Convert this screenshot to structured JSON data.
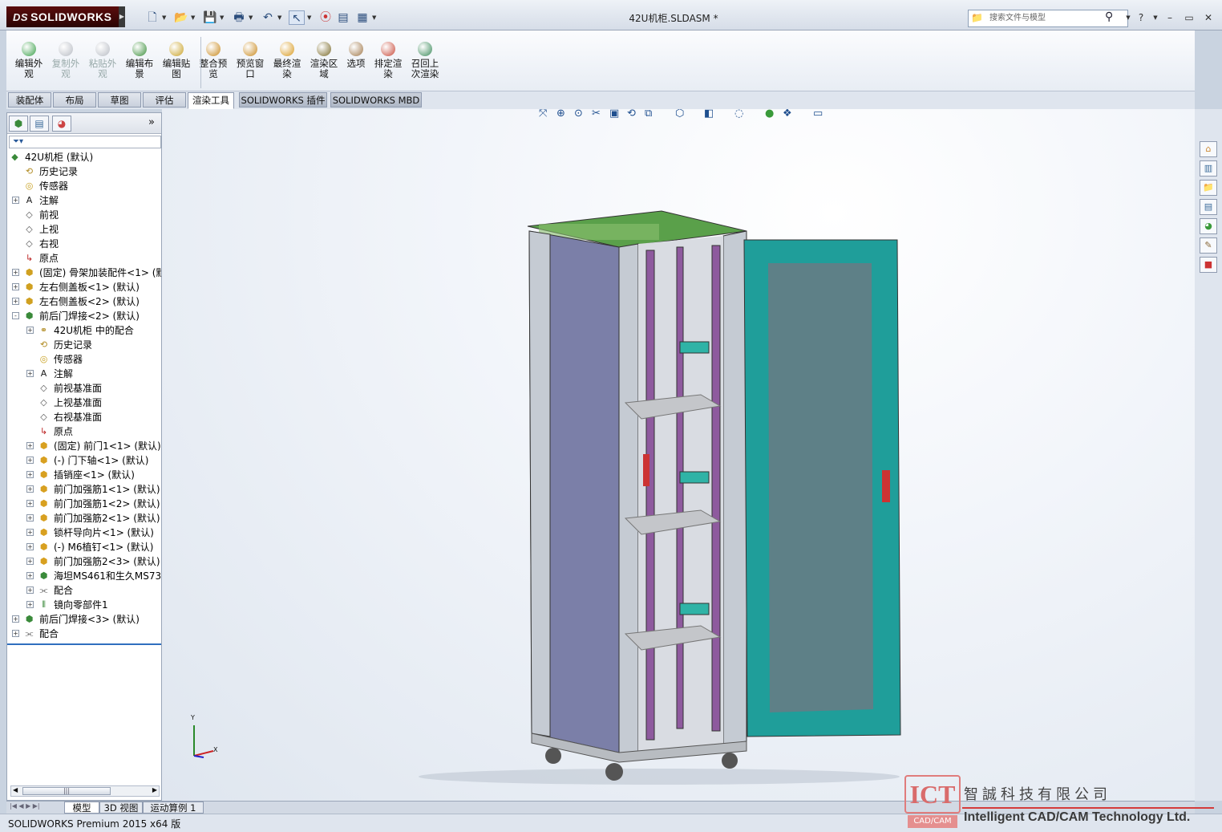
{
  "window": {
    "logo_prefix": "DS",
    "logo_text": "SOLIDWORKS",
    "title": "42U机柜.SLDASM *",
    "search_placeholder": "搜索文件与模型",
    "help_label": "?"
  },
  "ribbon": {
    "buttons": [
      {
        "label": "编辑外观",
        "color": "#3aa04a"
      },
      {
        "label": "复制外观",
        "color": "#b8bcc4"
      },
      {
        "label": "粘贴外观",
        "color": "#b8bcc4"
      },
      {
        "label": "编辑布景",
        "color": "#3b8f3b"
      },
      {
        "label": "编辑贴图",
        "color": "#c9a227"
      },
      {
        "label": "整合预览",
        "color": "#c98a1f"
      },
      {
        "label": "预览窗口",
        "color": "#c98a1f"
      },
      {
        "label": "最终渲染",
        "color": "#d89a20"
      },
      {
        "label": "渲染区域",
        "color": "#7a6a2a"
      },
      {
        "label": "选项",
        "color": "#a0784a"
      },
      {
        "label": "排定渲染",
        "color": "#c84a3a"
      },
      {
        "label": "召回上次渲染",
        "color": "#3a8a5a"
      }
    ]
  },
  "tabs": [
    "装配体",
    "布局",
    "草图",
    "评估",
    "渲染工具",
    "SOLIDWORKS 插件",
    "SOLIDWORKS MBD"
  ],
  "tree": {
    "rows": [
      {
        "label": "42U机柜  (默认)",
        "depth": 0,
        "exp": "",
        "icon": "asm"
      },
      {
        "label": "历史记录",
        "depth": 1,
        "exp": "",
        "icon": "history"
      },
      {
        "label": "传感器",
        "depth": 1,
        "exp": "",
        "icon": "sensor"
      },
      {
        "label": "注解",
        "depth": 1,
        "exp": "+",
        "icon": "note"
      },
      {
        "label": "前视",
        "depth": 1,
        "exp": "",
        "icon": "plane"
      },
      {
        "label": "上视",
        "depth": 1,
        "exp": "",
        "icon": "plane"
      },
      {
        "label": "右视",
        "depth": 1,
        "exp": "",
        "icon": "plane"
      },
      {
        "label": "原点",
        "depth": 1,
        "exp": "",
        "icon": "origin"
      },
      {
        "label": "(固定) 骨架加装配件<1> (默",
        "depth": 1,
        "exp": "+",
        "icon": "part"
      },
      {
        "label": "左右侧盖板<1> (默认)",
        "depth": 1,
        "exp": "+",
        "icon": "part"
      },
      {
        "label": "左右侧盖板<2> (默认)",
        "depth": 1,
        "exp": "+",
        "icon": "part"
      },
      {
        "label": "前后门焊接<2> (默认)",
        "depth": 1,
        "exp": "-",
        "icon": "subasm"
      },
      {
        "label": "42U机柜 中的配合",
        "depth": 2,
        "exp": "+",
        "icon": "mate-folder"
      },
      {
        "label": "历史记录",
        "depth": 2,
        "exp": "",
        "icon": "history"
      },
      {
        "label": "传感器",
        "depth": 2,
        "exp": "",
        "icon": "sensor"
      },
      {
        "label": "注解",
        "depth": 2,
        "exp": "+",
        "icon": "note"
      },
      {
        "label": "前视基准面",
        "depth": 2,
        "exp": "",
        "icon": "plane"
      },
      {
        "label": "上视基准面",
        "depth": 2,
        "exp": "",
        "icon": "plane"
      },
      {
        "label": "右视基准面",
        "depth": 2,
        "exp": "",
        "icon": "plane"
      },
      {
        "label": "原点",
        "depth": 2,
        "exp": "",
        "icon": "origin"
      },
      {
        "label": "(固定) 前门1<1> (默认)",
        "depth": 2,
        "exp": "+",
        "icon": "weld"
      },
      {
        "label": "(-) 门下轴<1> (默认)",
        "depth": 2,
        "exp": "+",
        "icon": "weld"
      },
      {
        "label": "插销座<1> (默认)",
        "depth": 2,
        "exp": "+",
        "icon": "weld"
      },
      {
        "label": "前门加强筋1<1> (默认)",
        "depth": 2,
        "exp": "+",
        "icon": "weld"
      },
      {
        "label": "前门加强筋1<2> (默认)",
        "depth": 2,
        "exp": "+",
        "icon": "weld"
      },
      {
        "label": "前门加强筋2<1> (默认)",
        "depth": 2,
        "exp": "+",
        "icon": "weld"
      },
      {
        "label": "锁杆导向片<1> (默认)",
        "depth": 2,
        "exp": "+",
        "icon": "weld"
      },
      {
        "label": "(-) M6植钉<1> (默认)",
        "depth": 2,
        "exp": "+",
        "icon": "weld"
      },
      {
        "label": "前门加强筋2<3> (默认)",
        "depth": 2,
        "exp": "+",
        "icon": "weld"
      },
      {
        "label": "海坦MS461和生久MS73",
        "depth": 2,
        "exp": "+",
        "icon": "subasm"
      },
      {
        "label": "配合",
        "depth": 2,
        "exp": "+",
        "icon": "mates"
      },
      {
        "label": "镜向零部件1",
        "depth": 2,
        "exp": "+",
        "icon": "mirror"
      },
      {
        "label": "前后门焊接<3> (默认)",
        "depth": 1,
        "exp": "+",
        "icon": "subasm"
      },
      {
        "label": "配合",
        "depth": 1,
        "exp": "+",
        "icon": "mates"
      }
    ]
  },
  "triad": {
    "y": "Y",
    "x": "X"
  },
  "bottom_tabs": [
    "模型",
    "3D 视图",
    "运动算例 1"
  ],
  "status": {
    "product": "SOLIDWORKS Premium 2015 x64 版"
  },
  "watermark": {
    "ict": "ICT",
    "cadcam": "CAD/CAM",
    "cn": "智誠科技有限公司",
    "en": "Intelligent CAD/CAM Technology Ltd."
  },
  "colors": {
    "cabinet_green": "#5aa04a",
    "cabinet_frame": "#c5cbd3",
    "side_panel": "#7b7fa8",
    "door_teal": "#1f9e9a",
    "mount_rail": "#8e5a9e",
    "rail_bracket": "#2fb3a6"
  }
}
